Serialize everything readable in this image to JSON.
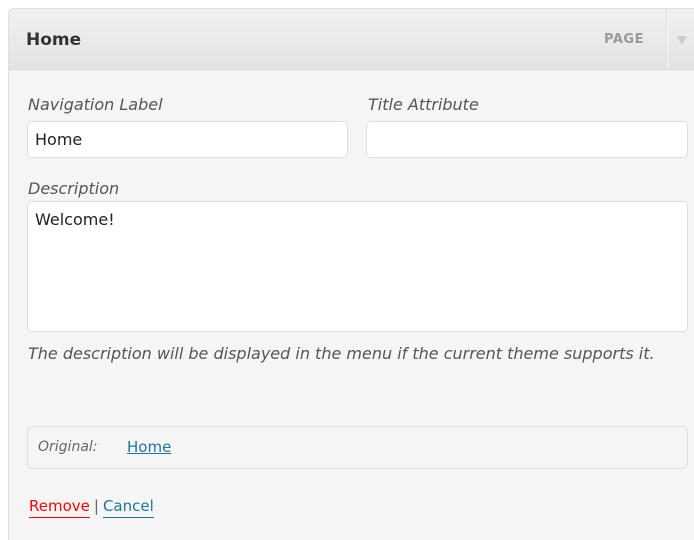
{
  "menu_item": {
    "title": "Home",
    "type": "PAGE"
  },
  "fields": {
    "navigation_label": {
      "label": "Navigation Label",
      "value": "Home"
    },
    "title_attribute": {
      "label": "Title Attribute",
      "value": ""
    },
    "description": {
      "label": "Description",
      "value": "Welcome!",
      "help": "The description will be displayed in the menu if the current theme supports it."
    }
  },
  "original": {
    "label": "Original:",
    "link": "Home"
  },
  "actions": {
    "remove": "Remove",
    "separator": "|",
    "cancel": "Cancel"
  },
  "colors": {
    "link": "#21759b",
    "remove": "#ff0000",
    "panel_background": "#f5f5f5",
    "header_background": "#e3e3e3"
  },
  "icons": {
    "toggle": "triangle-down-icon"
  }
}
